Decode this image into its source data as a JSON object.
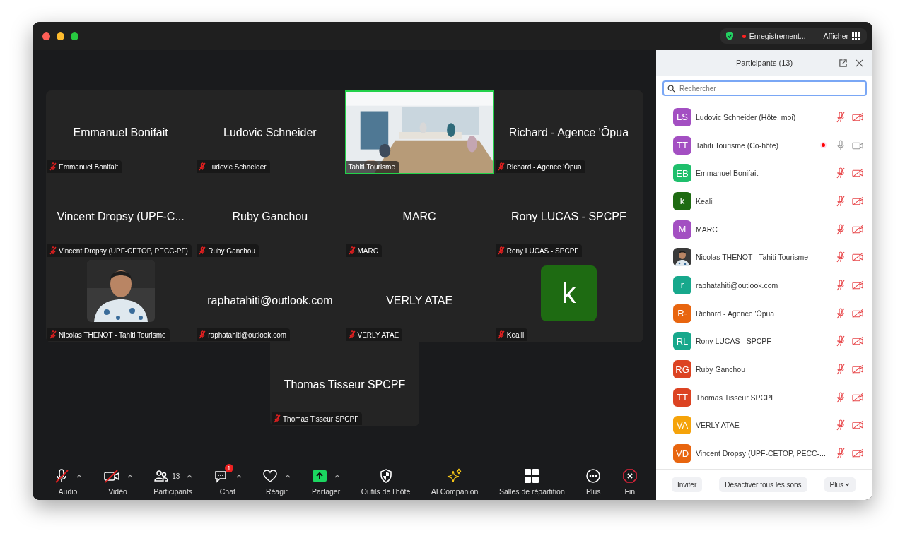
{
  "top_bar": {
    "recording_label": "Enregistrement...",
    "view_label": "Afficher"
  },
  "tiles": [
    {
      "kind": "name",
      "display": "Emmanuel Bonifait",
      "label": "Emmanuel Bonifait",
      "muted": true,
      "active": false
    },
    {
      "kind": "name",
      "display": "Ludovic Schneider",
      "label": "Ludovic Schneider",
      "muted": true,
      "active": false
    },
    {
      "kind": "picture",
      "label": "Tahiti Tourisme",
      "muted": false,
      "active": true
    },
    {
      "kind": "name",
      "display": "Richard - Agence 'Ōpua",
      "label": "Richard - Agence 'Ōpua",
      "muted": true,
      "active": false
    },
    {
      "kind": "name",
      "display": "Vincent Dropsy (UPF-C...",
      "label": "Vincent Dropsy (UPF-CETOP, PECC-PF)",
      "muted": true,
      "active": false
    },
    {
      "kind": "name",
      "display": "Ruby Ganchou",
      "label": "Ruby Ganchou",
      "muted": true,
      "active": false
    },
    {
      "kind": "name",
      "display": "MARC",
      "label": "MARC",
      "muted": true,
      "active": false
    },
    {
      "kind": "name",
      "display": "Rony LUCAS - SPCPF",
      "label": "Rony LUCAS - SPCPF",
      "muted": true,
      "active": false
    },
    {
      "label": "Nicolas THENOT - Tahiti Tourisme",
      "muted": true,
      "active": false
    },
    {
      "kind": "name",
      "display": "raphatahiti@outlook.com",
      "label": "raphatahiti@outlook.com",
      "muted": true,
      "active": false
    },
    {
      "kind": "name",
      "display": "VERLY ATAE",
      "label": "VERLY ATAE",
      "muted": true,
      "active": false
    },
    {
      "kind": "avatar",
      "initial": "k",
      "color": "#1e6b12",
      "label": "Kealii",
      "muted": true,
      "active": false
    },
    {
      "kind": "name",
      "display": "Thomas Tisseur SPCPF",
      "label": "Thomas Tisseur SPCPF",
      "muted": true,
      "active": false
    }
  ],
  "toolbar": [
    {
      "kind": "mic",
      "label": "Audio",
      "caret": true,
      "off": true
    },
    {
      "kind": "video",
      "label": "Vidéo",
      "caret": true,
      "off": true
    },
    {
      "kind": "people",
      "label": "Participants",
      "count": "13",
      "caret": true
    },
    {
      "kind": "chat",
      "label": "Chat",
      "badge": "1",
      "caret": true
    },
    {
      "kind": "heart",
      "label": "Réagir",
      "caret": true
    },
    {
      "kind": "share",
      "label": "Partager",
      "caret": true
    },
    {
      "kind": "shield",
      "label": "Outils de l’hôte",
      "caret": false
    },
    {
      "kind": "sparkle",
      "label": "AI Companion",
      "caret": false
    },
    {
      "kind": "grid",
      "label": "Salles de répartition",
      "caret": false
    },
    {
      "kind": "more",
      "label": "Plus",
      "caret": false
    },
    {
      "kind": "end",
      "label": "Fin",
      "caret": false
    }
  ],
  "panel": {
    "title": "Participants (13)",
    "search": {
      "placeholder": "Rechercher"
    },
    "participants": [
      {
        "kind": "initials",
        "initials": "LS",
        "color": "#a34fc2",
        "name": "Ludovic Schneider (Hôte, moi)",
        "recording": false,
        "muted": true,
        "video_off": true
      },
      {
        "kind": "initials",
        "initials": "TT",
        "color": "#a34fc2",
        "name": "Tahiti Tourisme (Co-hôte)",
        "recording": true,
        "muted": false,
        "video_off": false
      },
      {
        "kind": "initials",
        "initials": "EB",
        "color": "#1fbf6c",
        "name": "Emmanuel Bonifait",
        "recording": false,
        "muted": true,
        "video_off": true
      },
      {
        "kind": "initials",
        "initials": "k",
        "color": "#1e6b12",
        "name": "Kealii",
        "recording": false,
        "muted": true,
        "video_off": true
      },
      {
        "kind": "initials",
        "initials": "M",
        "color": "#a34fc2",
        "name": "MARC",
        "recording": false,
        "muted": true,
        "video_off": true
      },
      {
        "name": "Nicolas THENOT - Tahiti Tourisme",
        "recording": false,
        "muted": true,
        "video_off": true
      },
      {
        "kind": "initials",
        "initials": "r",
        "color": "#17a88c",
        "name": "raphatahiti@outlook.com",
        "recording": false,
        "muted": true,
        "video_off": true
      },
      {
        "kind": "initials",
        "initials": "R-",
        "color": "#e8650f",
        "name": "Richard - Agence 'Ōpua",
        "recording": false,
        "muted": true,
        "video_off": true
      },
      {
        "kind": "initials",
        "initials": "RL",
        "color": "#17a88c",
        "name": "Rony LUCAS - SPCPF",
        "recording": false,
        "muted": true,
        "video_off": true
      },
      {
        "kind": "initials",
        "initials": "RG",
        "color": "#dc4322",
        "name": "Ruby Ganchou",
        "recording": false,
        "muted": true,
        "video_off": true
      },
      {
        "kind": "initials",
        "initials": "TT",
        "color": "#dc4322",
        "name": "Thomas Tisseur SPCPF",
        "recording": false,
        "muted": true,
        "video_off": true
      },
      {
        "kind": "initials",
        "initials": "VA",
        "color": "#f5a30a",
        "name": "VERLY ATAE",
        "recording": false,
        "muted": true,
        "video_off": true
      },
      {
        "kind": "initials",
        "initials": "VD",
        "color": "#e8650f",
        "name": "Vincent Dropsy (UPF-CETOP, PECC-...",
        "recording": false,
        "muted": true,
        "video_off": true
      }
    ],
    "buttons": [
      {
        "kind": "plain",
        "label": "Inviter"
      },
      {
        "kind": "plain",
        "label": "Désactiver tous les sons"
      },
      {
        "kind": "menu",
        "label": "Plus"
      }
    ]
  }
}
